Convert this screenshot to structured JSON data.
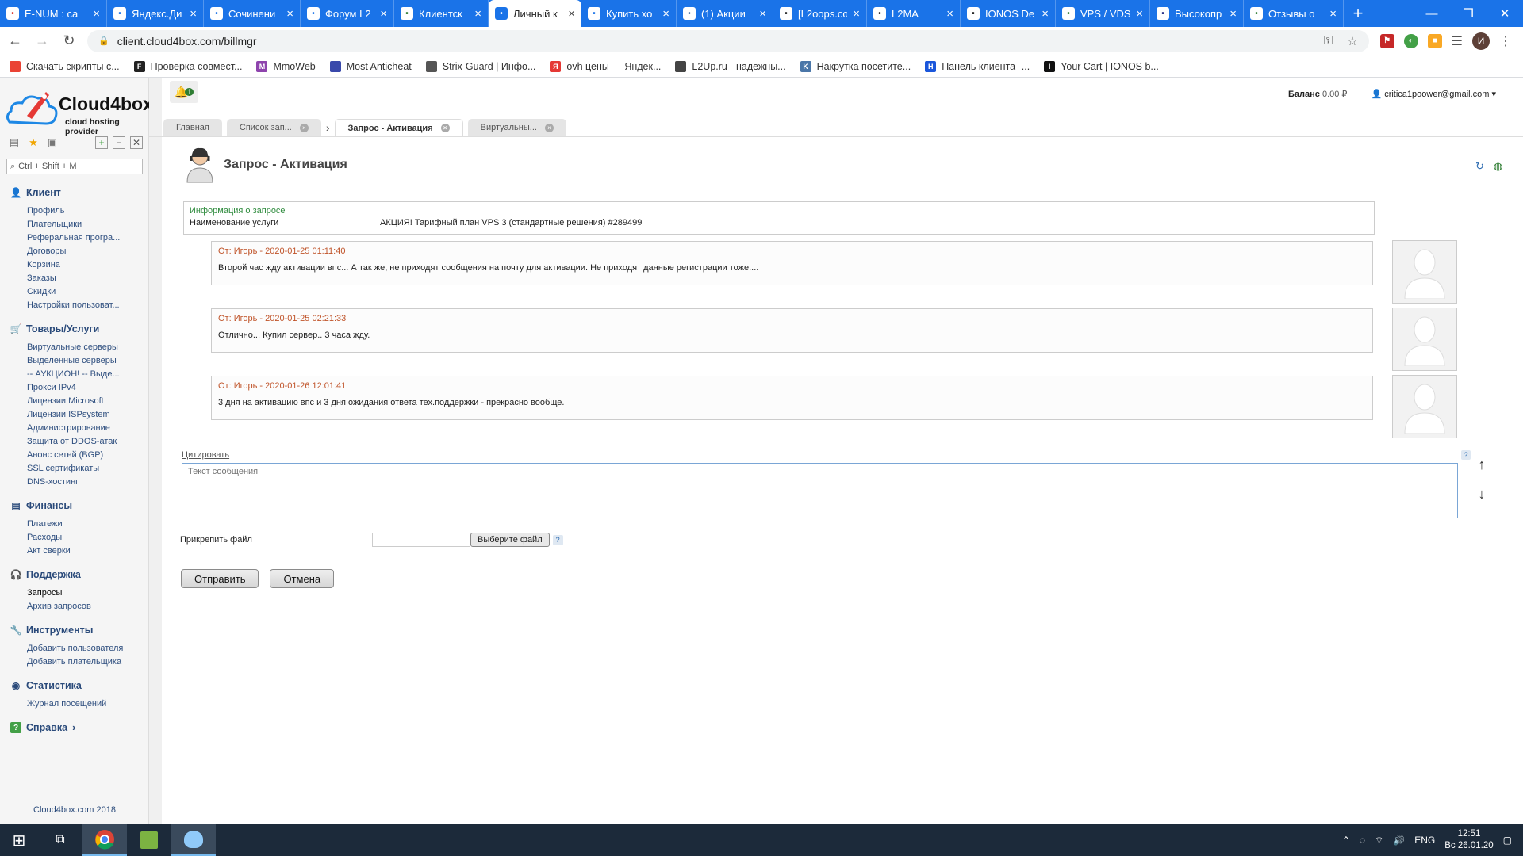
{
  "browser": {
    "tabs": [
      {
        "title": "E-NUM : ca",
        "icon": "gmail-icon",
        "color": "#d93025"
      },
      {
        "title": "Яндекс.Ди",
        "icon": "yandex-disk-icon",
        "color": "#1a73e8"
      },
      {
        "title": "Сочинени",
        "icon": "document-icon",
        "color": "#1a73e8"
      },
      {
        "title": "Форум L2",
        "icon": "forum-icon",
        "color": "#1a73e8"
      },
      {
        "title": "Клиентск",
        "icon": "f-icon",
        "color": "#2e7d32"
      },
      {
        "title": "Личный к",
        "icon": "cloud-icon",
        "color": "#1a73e8",
        "active": true
      },
      {
        "title": "Купить хо",
        "icon": "cart-icon",
        "color": "#1a73e8"
      },
      {
        "title": "(1) Акции",
        "icon": "vk-icon",
        "color": "#4a76a8"
      },
      {
        "title": "[L2oops.co",
        "icon": "l2-icon",
        "color": "#222"
      },
      {
        "title": "L2MA",
        "icon": "l2ma-icon",
        "color": "#222"
      },
      {
        "title": "IONOS De",
        "icon": "ionos-icon",
        "color": "#111"
      },
      {
        "title": "VPS / VDS",
        "icon": "vps-icon",
        "color": "#2e7d32"
      },
      {
        "title": "Высокопр",
        "icon": "z-icon",
        "color": "#1a237e"
      },
      {
        "title": "Отзывы о",
        "icon": "review-icon",
        "color": "#2e7d32"
      }
    ],
    "url": "client.cloud4box.com/billmgr",
    "profile_initial": "И",
    "bookmarks": [
      {
        "label": "Скачать скрипты с...",
        "color": "#ea4335",
        "glyph": ""
      },
      {
        "label": "Проверка совмест...",
        "color": "#222",
        "glyph": "F"
      },
      {
        "label": "MmoWeb",
        "color": "#8e44ad",
        "glyph": "M"
      },
      {
        "label": "Most Anticheat",
        "color": "#3949ab",
        "glyph": ""
      },
      {
        "label": "Strix-Guard | Инфо...",
        "color": "#555",
        "glyph": ""
      },
      {
        "label": "ovh цены — Яндек...",
        "color": "#e53935",
        "glyph": "Я"
      },
      {
        "label": "L2Up.ru - надежны...",
        "color": "#444",
        "glyph": ""
      },
      {
        "label": "Накрутка посетите...",
        "color": "#4a76a8",
        "glyph": "K"
      },
      {
        "label": "Панель клиента -...",
        "color": "#1a56db",
        "glyph": "H"
      },
      {
        "label": "Your Cart | IONOS b...",
        "color": "#111",
        "glyph": "I"
      }
    ]
  },
  "app": {
    "logo_name": "Cloud4box",
    "logo_sub": "cloud hosting provider",
    "search_placeholder": "Ctrl + Shift + M",
    "balance_label": "Баланс",
    "balance_value": "0.00 ₽",
    "user_email": "critica1poower@gmail.com",
    "bell_count": "1",
    "tabs": [
      {
        "label": "Главная",
        "closable": false
      },
      {
        "label": "Список зап...",
        "closable": true
      },
      {
        "label": "Запрос - Активация",
        "closable": true,
        "active": true
      },
      {
        "label": "Виртуальны...",
        "closable": true
      }
    ],
    "sidebar": [
      {
        "title": "Клиент",
        "icon": "client-icon",
        "items": [
          "Профиль",
          "Плательщики",
          "Реферальная програ...",
          "Договоры",
          "Корзина",
          "Заказы",
          "Скидки",
          "Настройки пользоват..."
        ]
      },
      {
        "title": "Товары/Услуги",
        "icon": "cart-icon",
        "items": [
          "Виртуальные серверы",
          "Выделенные серверы",
          "-- АУКЦИОН! -- Выде...",
          "Прокси IPv4",
          "Лицензии Microsoft",
          "Лицензии ISPsystem",
          "Администрирование",
          "Защита от DDOS-атак",
          "Анонс сетей (BGP)",
          "SSL сертификаты",
          "DNS-хостинг"
        ]
      },
      {
        "title": "Финансы",
        "icon": "finance-icon",
        "items": [
          "Платежи",
          "Расходы",
          "Акт сверки"
        ]
      },
      {
        "title": "Поддержка",
        "icon": "support-icon",
        "items": [
          "Запросы",
          "Архив запросов"
        ],
        "current": "Запросы"
      },
      {
        "title": "Инструменты",
        "icon": "tools-icon",
        "items": [
          "Добавить пользователя",
          "Добавить плательщика"
        ]
      },
      {
        "title": "Статистика",
        "icon": "stats-icon",
        "items": [
          "Журнал посещений"
        ]
      },
      {
        "title": "Справка",
        "icon": "help-icon",
        "items": []
      }
    ],
    "footer": "Cloud4box.com 2018",
    "page_title": "Запрос - Активация",
    "info": {
      "heading": "Информация о запросе",
      "label": "Наименование услуги",
      "value": "АКЦИЯ! Тарифный план VPS 3 (стандартные решения) #289499"
    },
    "messages": [
      {
        "header": "От: Игорь - 2020-01-25 01:11:40",
        "text": "Второй час жду активации впс... А так же, не приходят сообщения на почту для активации. Не приходят данные регистрации тоже...."
      },
      {
        "header": "От: Игорь - 2020-01-25 02:21:33",
        "text": "Отлично... Купил сервер.. 3 часа жду."
      },
      {
        "header": "От: Игорь - 2020-01-26 12:01:41",
        "text": "3 дня на активацию впс и 3 дня ожидания ответа тех.поддержки - прекрасно вообще."
      }
    ],
    "quote_label": "Цитировать",
    "message_placeholder": "Текст сообщения",
    "attach_label": "Прикрепить файл",
    "choose_file": "Выберите файл",
    "send": "Отправить",
    "cancel": "Отмена"
  },
  "taskbar": {
    "lang": "ENG",
    "time": "12:51",
    "date": "Вс 26.01.20"
  }
}
